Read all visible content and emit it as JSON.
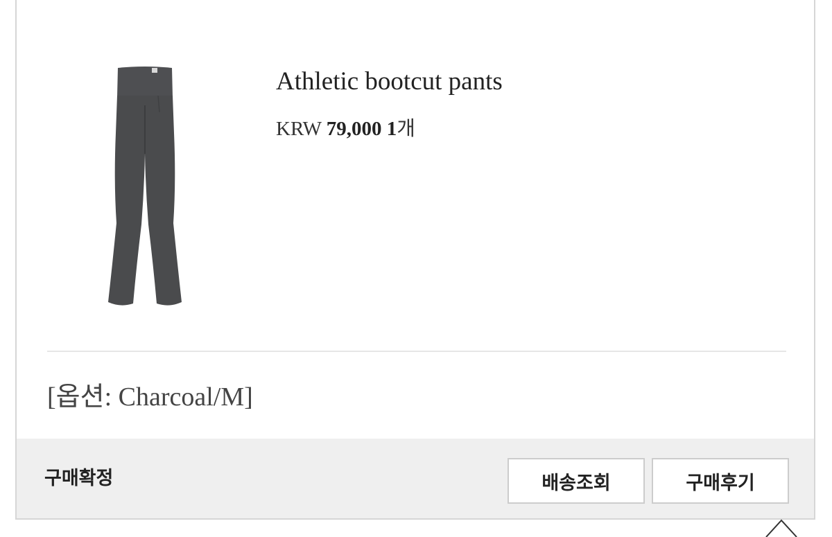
{
  "product": {
    "name": "Athletic bootcut pants",
    "currency": "KRW",
    "price": "79,000",
    "quantity": "1",
    "quantity_unit": "개",
    "image_icon": "pants-product-image",
    "image_color": "#4a4b4d"
  },
  "option": {
    "text": "[옵션: Charcoal/M]"
  },
  "footer": {
    "status": "구매확정",
    "track_button": "배송조회",
    "review_button": "구매후기"
  },
  "colors": {
    "footer_bg": "#efefef",
    "border": "#d6d6d6"
  }
}
